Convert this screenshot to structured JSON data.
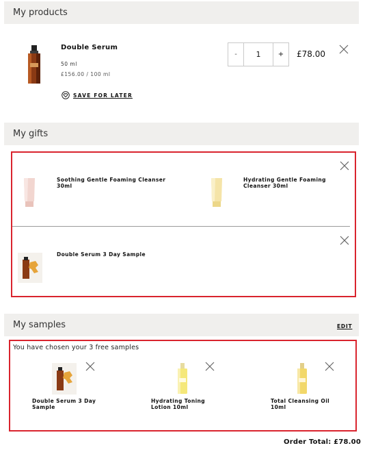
{
  "sections": {
    "products_title": "My products",
    "gifts_title": "My gifts",
    "samples_title": "My samples"
  },
  "product": {
    "name": "Double Serum",
    "size": "50 ml",
    "unit_price": "£156.00 / 100 ml",
    "save_for_later": "SAVE FOR LATER",
    "quantity": "1",
    "minus": "-",
    "plus": "+",
    "price": "£78.00",
    "image_icon": "serum-bottle-icon"
  },
  "gifts": [
    {
      "name": "Soothing Gentle Foaming Cleanser 30ml",
      "image_icon": "pink-tube-icon"
    },
    {
      "name": "Hydrating Gentle Foaming Cleanser 30ml",
      "image_icon": "yellow-tube-icon"
    },
    {
      "name": "Double Serum 3 Day Sample",
      "image_icon": "serum-sample-icon"
    }
  ],
  "samples": {
    "edit_label": "EDIT",
    "note": "You have chosen your 3 free samples",
    "items": [
      {
        "name": "Double Serum 3 Day Sample",
        "image_icon": "serum-sample-icon"
      },
      {
        "name": "Hydrating Toning Lotion 10ml",
        "image_icon": "lotion-bottle-icon"
      },
      {
        "name": "Total Cleansing Oil 10ml",
        "image_icon": "oil-bottle-icon"
      }
    ]
  },
  "order_total": "Order Total: £78.00",
  "colors": {
    "highlight": "#d9232d",
    "header_bg": "#f0efed",
    "serum": "#8a3a14",
    "gold": "#e6a43a"
  }
}
